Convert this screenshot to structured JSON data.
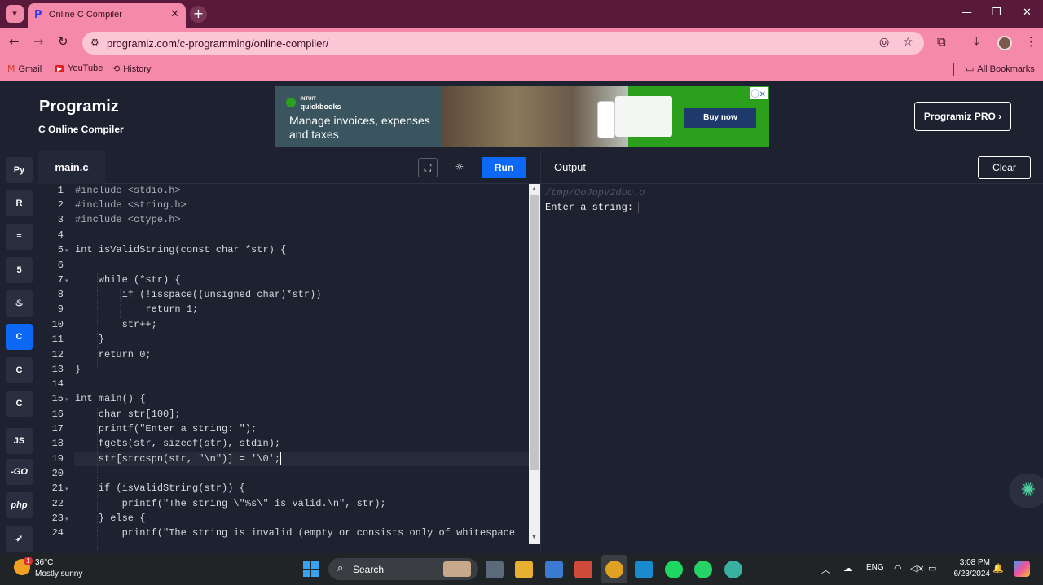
{
  "browser": {
    "tab_title": "Online C Compiler",
    "url": "programiz.com/c-programming/online-compiler/",
    "bookmarks": [
      {
        "label": "Gmail",
        "icon": "gmail-icon"
      },
      {
        "label": "YouTube",
        "icon": "youtube-icon"
      },
      {
        "label": "History",
        "icon": "history-icon"
      }
    ],
    "all_bookmarks": "All Bookmarks"
  },
  "site": {
    "logo": "Programiz",
    "subtitle": "C Online Compiler",
    "pro_button": "Programiz PRO ›"
  },
  "ad": {
    "brand_top": "INTUIT",
    "brand": "quickbooks",
    "headline": "Manage invoices, expenses and taxes",
    "cta": "Buy now"
  },
  "sidebar": {
    "languages": [
      {
        "name": "python",
        "label": "Py"
      },
      {
        "name": "r",
        "label": "R"
      },
      {
        "name": "sql",
        "label": "≡"
      },
      {
        "name": "html",
        "label": "5"
      },
      {
        "name": "java",
        "label": "♨"
      },
      {
        "name": "c",
        "label": "C"
      },
      {
        "name": "cpp",
        "label": "C"
      },
      {
        "name": "csharp",
        "label": "C"
      },
      {
        "name": "js",
        "label": "JS"
      },
      {
        "name": "go",
        "label": "-GO"
      },
      {
        "name": "php",
        "label": "php"
      },
      {
        "name": "swift",
        "label": "➶"
      }
    ]
  },
  "editor": {
    "file_tab": "main.c",
    "run_label": "Run",
    "lines": [
      {
        "n": "1",
        "t": "#include <stdio.h>"
      },
      {
        "n": "2",
        "t": "#include <string.h>"
      },
      {
        "n": "3",
        "t": "#include <ctype.h>"
      },
      {
        "n": "4",
        "t": ""
      },
      {
        "n": "5",
        "t": "int isValidString(const char *str) {"
      },
      {
        "n": "6",
        "t": ""
      },
      {
        "n": "7",
        "t": "    while (*str) {"
      },
      {
        "n": "8",
        "t": "        if (!isspace((unsigned char)*str))"
      },
      {
        "n": "9",
        "t": "            return 1;"
      },
      {
        "n": "10",
        "t": "        str++;"
      },
      {
        "n": "11",
        "t": "    }"
      },
      {
        "n": "12",
        "t": "    return 0;"
      },
      {
        "n": "13",
        "t": "}"
      },
      {
        "n": "14",
        "t": ""
      },
      {
        "n": "15",
        "t": "int main() {"
      },
      {
        "n": "16",
        "t": "    char str[100];"
      },
      {
        "n": "17",
        "t": "    printf(\"Enter a string: \");"
      },
      {
        "n": "18",
        "t": "    fgets(str, sizeof(str), stdin);"
      },
      {
        "n": "19",
        "t": "    str[strcspn(str, \"\\n\")] = '\\0';"
      },
      {
        "n": "20",
        "t": ""
      },
      {
        "n": "21",
        "t": "    if (isValidString(str)) {"
      },
      {
        "n": "22",
        "t": "        printf(\"The string \\\"%s\\\" is valid.\\n\", str);"
      },
      {
        "n": "23",
        "t": "    } else {"
      },
      {
        "n": "24",
        "t": "        printf(\"The string is invalid (empty or consists only of whitespace"
      }
    ]
  },
  "output": {
    "title": "Output",
    "clear_label": "Clear",
    "path": "/tmp/OoJopV2dUo.o",
    "text": "Enter a string:"
  },
  "taskbar": {
    "weather_badge": "1",
    "temperature": "36°C",
    "condition": "Mostly sunny",
    "search_label": "Search",
    "lang": "ENG",
    "time": "3:08 PM",
    "date": "6/23/2024"
  }
}
